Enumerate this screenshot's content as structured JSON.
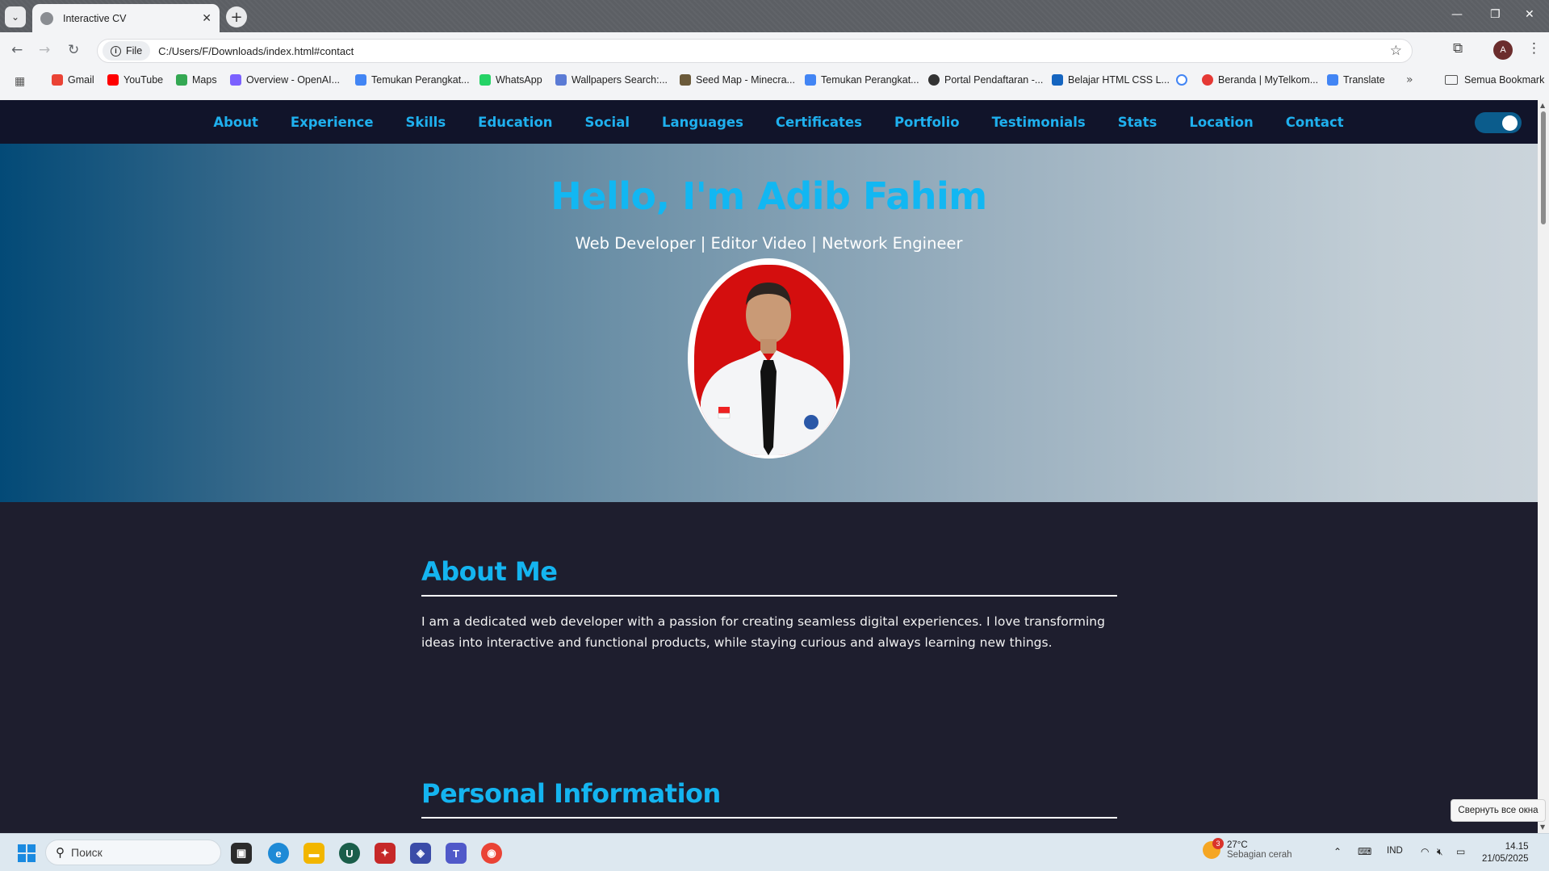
{
  "browser": {
    "tab_title": "Interactive CV",
    "site_chip": "File",
    "url": "C:/Users/F/Downloads/index.html#contact",
    "bookmarks": [
      {
        "label": "Gmail",
        "color": "#ea4335"
      },
      {
        "label": "YouTube",
        "color": "#ff0000"
      },
      {
        "label": "Maps",
        "color": "#34a853"
      },
      {
        "label": "Overview - OpenAI...",
        "color": "#7b61ff"
      },
      {
        "label": "Temukan Perangkat...",
        "color": "#4285f4"
      },
      {
        "label": "WhatsApp",
        "color": "#25d366"
      },
      {
        "label": "Wallpapers Search:...",
        "color": "#5b7bd5"
      },
      {
        "label": "Seed Map - Minecra...",
        "color": "#6b5a3a"
      },
      {
        "label": "Temukan Perangkat...",
        "color": "#4285f4"
      },
      {
        "label": "Portal Pendaftaran -...",
        "color": "#333333"
      },
      {
        "label": "Belajar HTML CSS L...",
        "color": "#1565c0"
      },
      {
        "label": "",
        "color": "#4285f4"
      },
      {
        "label": "Beranda | MyTelkom...",
        "color": "#e53935"
      },
      {
        "label": "Translate",
        "color": "#4285f4"
      }
    ],
    "all_bookmarks": "Semua Bookmark",
    "profile_initial": "A"
  },
  "site": {
    "nav": [
      "About",
      "Experience",
      "Skills",
      "Education",
      "Social",
      "Languages",
      "Certificates",
      "Portfolio",
      "Testimonials",
      "Stats",
      "Location",
      "Contact"
    ],
    "hero": {
      "title": "Hello, I'm Adib Fahim",
      "subtitle": "Web Developer | Editor Video | Network Engineer"
    },
    "about": {
      "title": "About Me",
      "text": "I am a dedicated web developer with a passion for creating seamless digital experiences. I love transforming ideas into interactive and functional products, while staying curious and always learning new things."
    },
    "personal": {
      "title": "Personal Information"
    },
    "accent_color": "#14b4f0"
  },
  "os": {
    "tooltip": "Свернуть все окна",
    "search_placeholder": "Поиск",
    "weather_temp": "27°C",
    "weather_desc": "Sebagian cerah",
    "weather_badge": "3",
    "lang": "IND",
    "time": "14.15",
    "date": "21/05/2025"
  }
}
